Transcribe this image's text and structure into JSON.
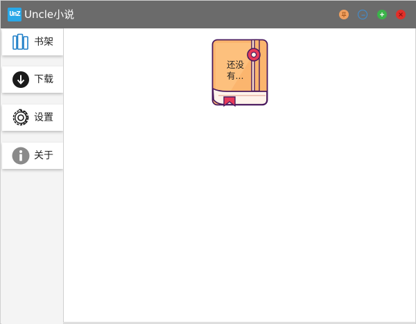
{
  "window": {
    "logo_text": "UnZ",
    "title": "Uncle小说",
    "controls": [
      "pin",
      "minimize",
      "maximize",
      "close"
    ],
    "colors": {
      "titlebar": "#6b6b6b",
      "pin": "#f0a060",
      "minimize": "#3f8fd6",
      "maximize": "#3bb34a",
      "close": "#e0302a",
      "logo": "#29a8e8"
    }
  },
  "sidebar": {
    "items": [
      {
        "label": "书架",
        "icon": "bookshelf-icon"
      },
      {
        "label": "下载",
        "icon": "download-icon"
      },
      {
        "label": "设置",
        "icon": "gear-icon"
      },
      {
        "label": "关于",
        "icon": "info-icon"
      }
    ]
  },
  "main": {
    "empty_book": {
      "line1": "还没",
      "line2": "有..."
    }
  }
}
